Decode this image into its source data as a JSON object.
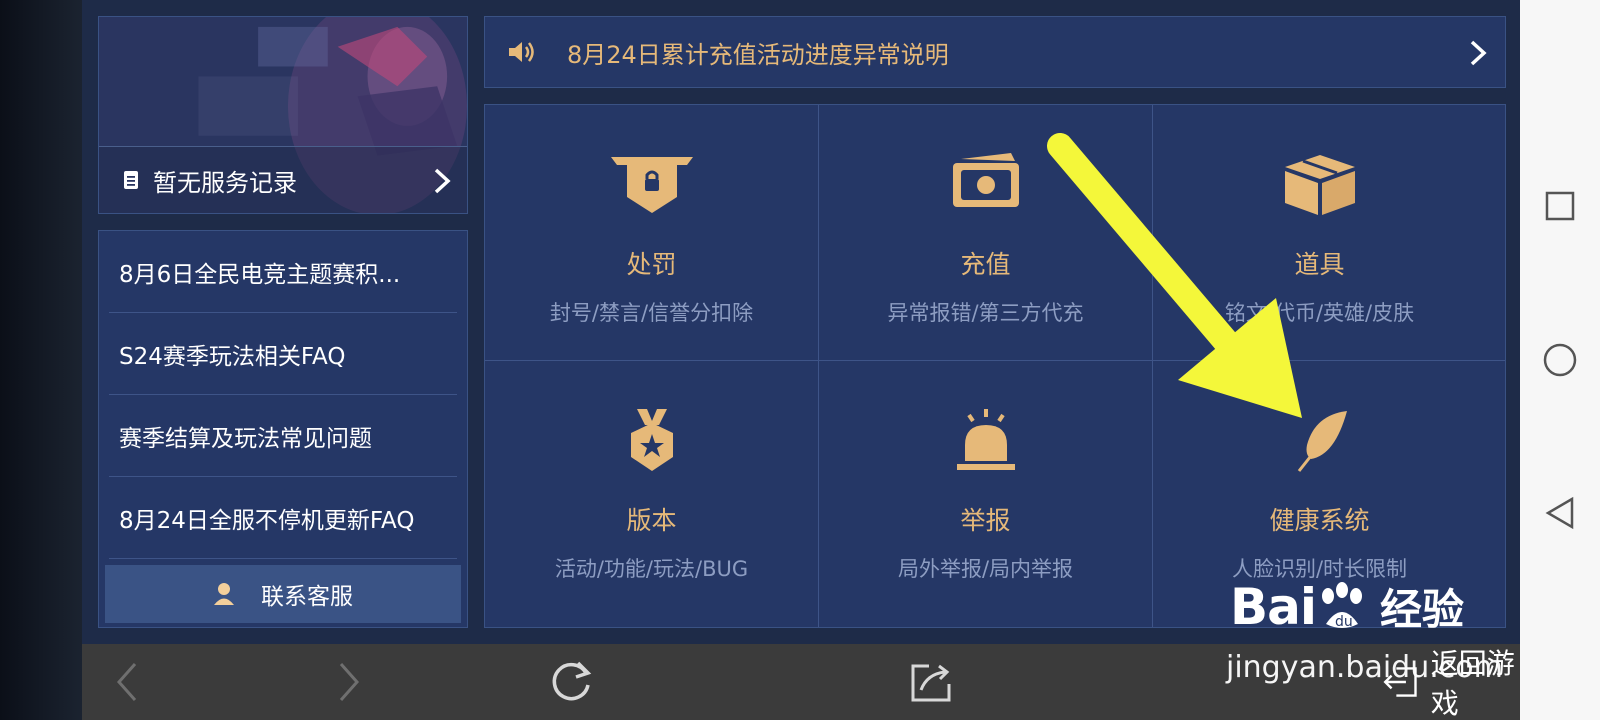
{
  "banner": {
    "service_record_label": "暂无服务记录"
  },
  "faq": {
    "items": [
      "8月6日全民电竞主题赛积...",
      "S24赛季玩法相关FAQ",
      "赛季结算及玩法常见问题",
      "8月24日全服不停机更新FAQ"
    ],
    "contact_label": "联系客服"
  },
  "notice": {
    "text": "8月24日累计充值活动进度异常说明"
  },
  "categories": [
    {
      "title": "处罚",
      "sub": "封号/禁言/信誉分扣除",
      "icon": "penalty-shield-lock-icon"
    },
    {
      "title": "充值",
      "sub": "异常报错/第三方代充",
      "icon": "recharge-money-icon"
    },
    {
      "title": "道具",
      "sub": "铭文/代币/英雄/皮肤",
      "icon": "item-box-icon"
    },
    {
      "title": "版本",
      "sub": "活动/功能/玩法/BUG",
      "icon": "version-medal-icon"
    },
    {
      "title": "举报",
      "sub": "局外举报/局内举报",
      "icon": "report-alarm-icon"
    },
    {
      "title": "健康系统",
      "sub": "人脸识别/时长限制",
      "icon": "health-feather-icon"
    }
  ],
  "bottom_bar": {
    "return_label": "返回游戏"
  },
  "watermark": {
    "logo_text": "Bai",
    "logo_cn": "经验",
    "url": "jingyan.baidu.com"
  },
  "colors": {
    "accent_gold": "#e6b979",
    "panel_bg": "#253766",
    "annotation_arrow": "#f4f73a"
  }
}
